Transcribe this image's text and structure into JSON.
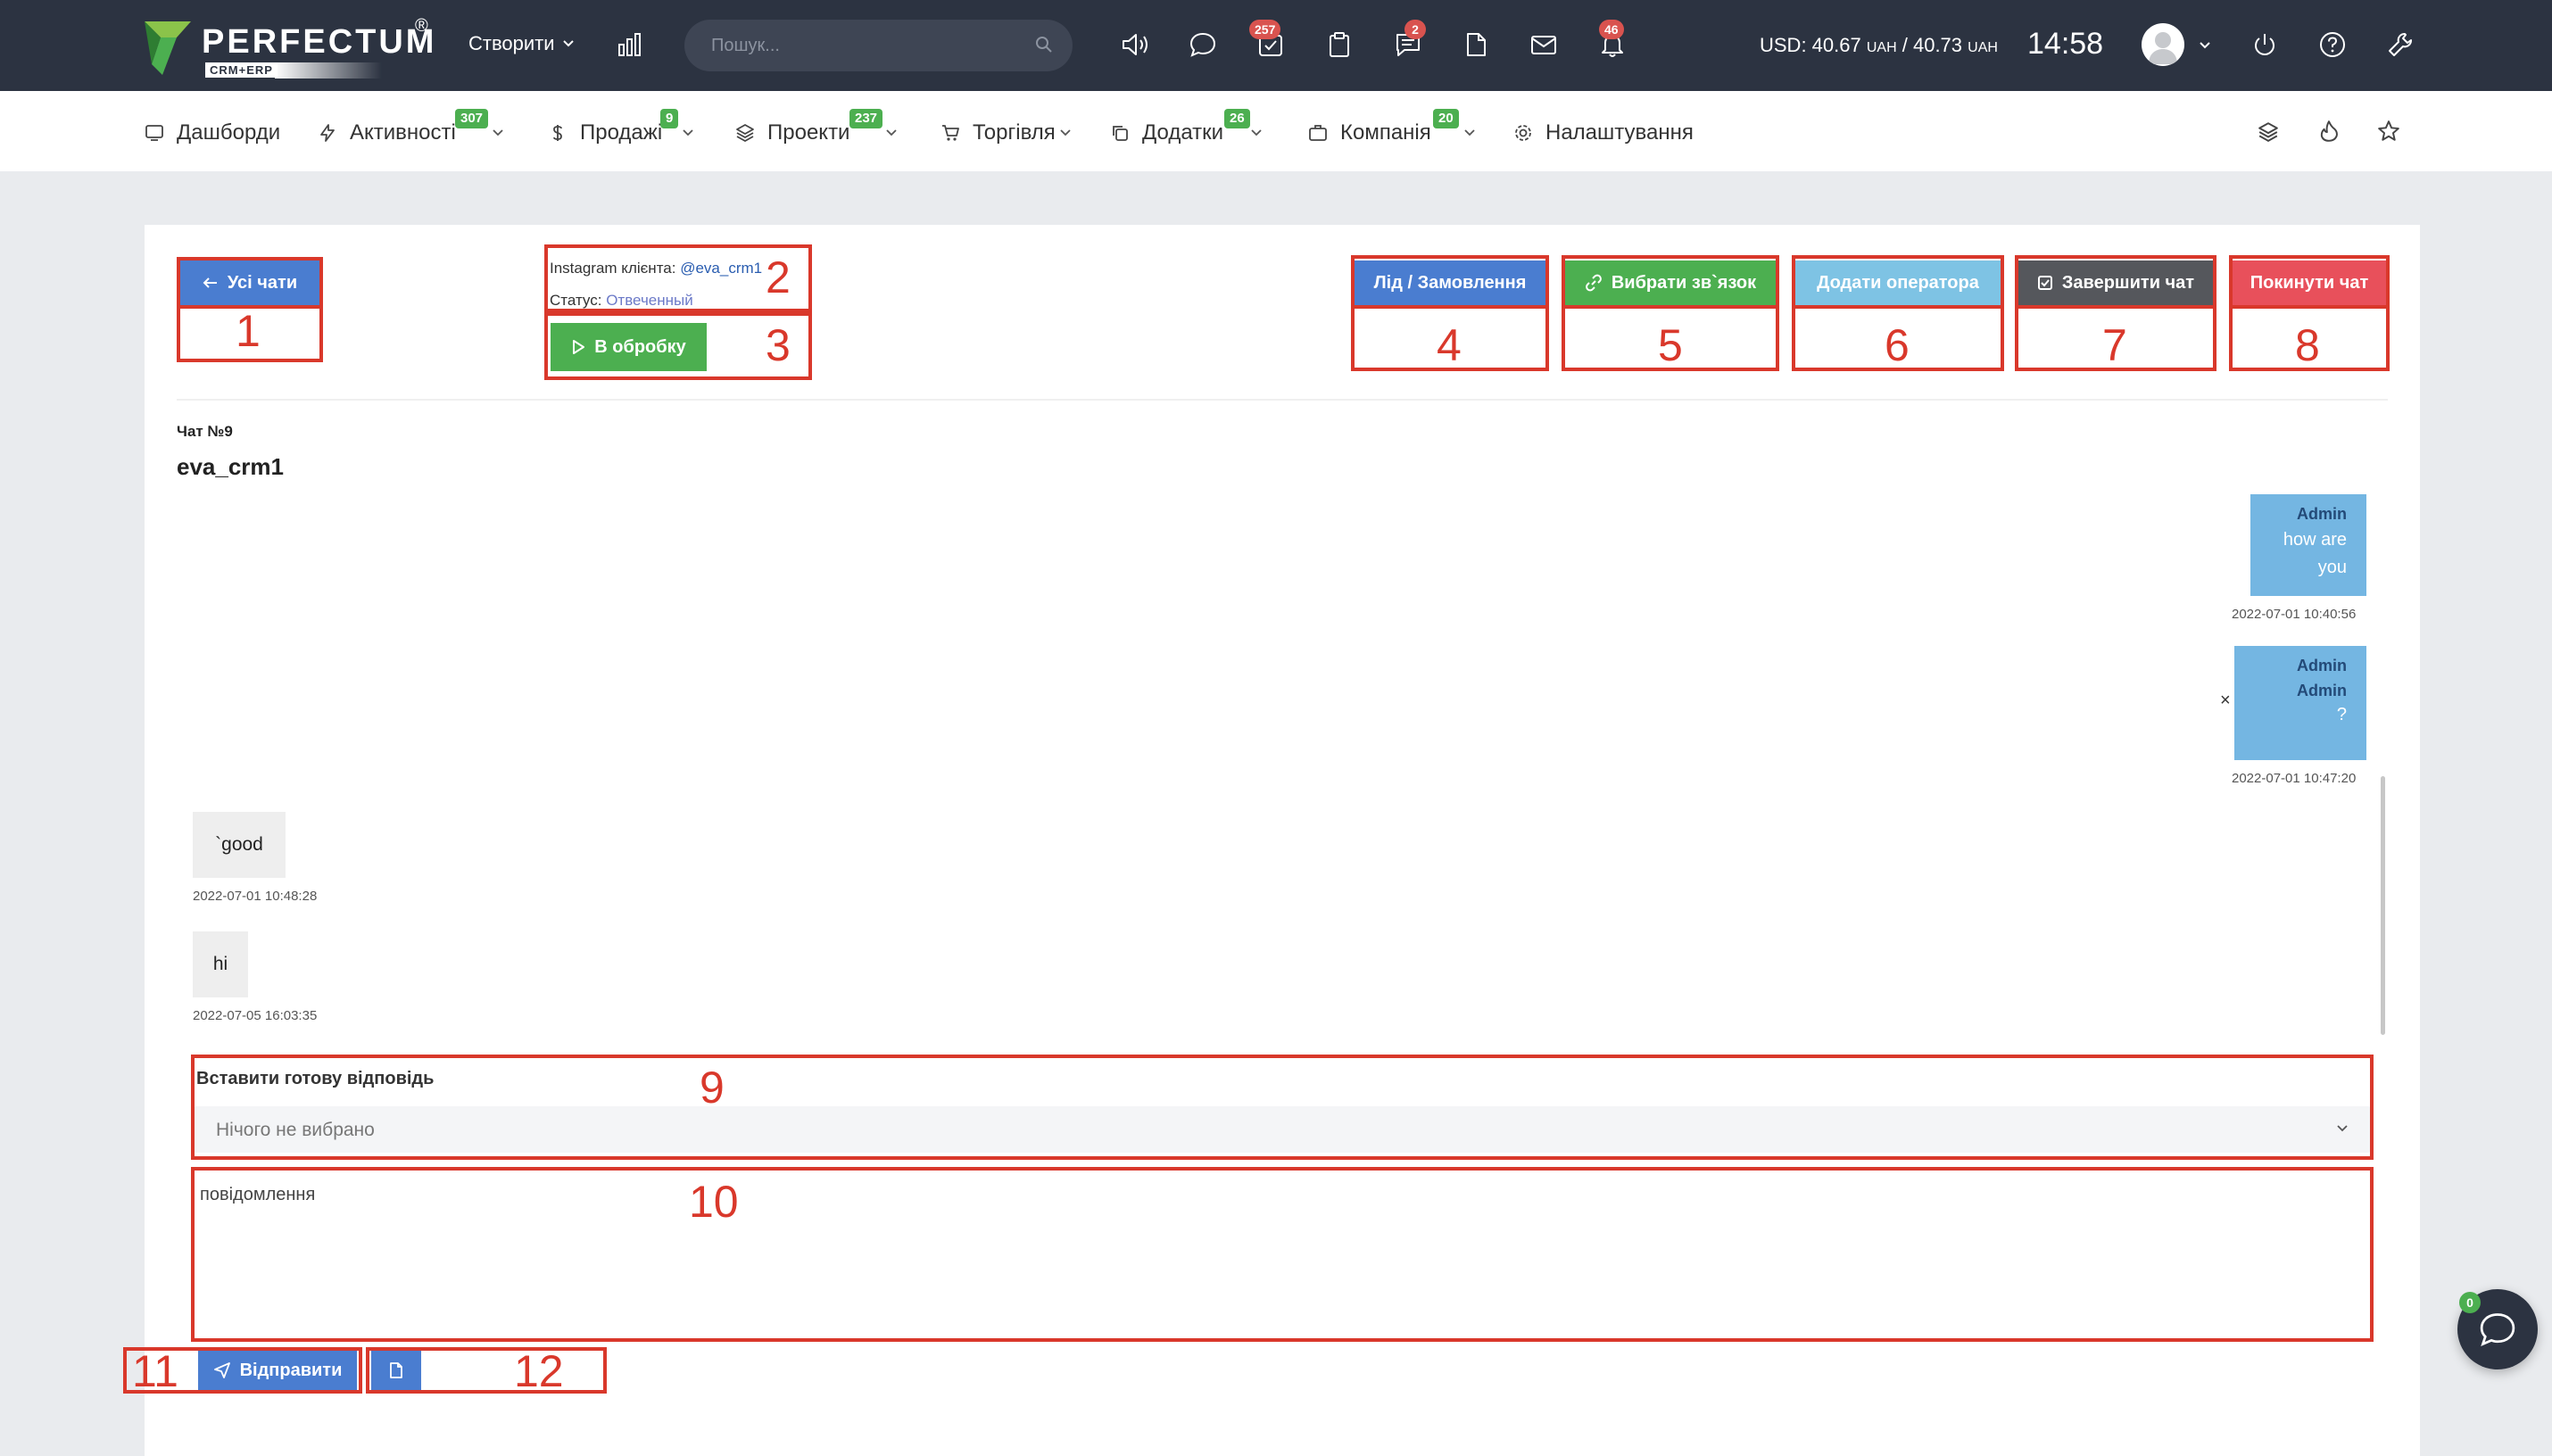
{
  "brand": {
    "name": "PERFECTUM",
    "reg": "®",
    "subtitle": "CRM+ERP"
  },
  "topbar": {
    "create_label": "Створити",
    "search_placeholder": "Пошук...",
    "badges": {
      "tasks": "257",
      "chat": "2",
      "notifications": "46"
    },
    "currency_text": "USD: 40.67",
    "currency_unit1": "UAH",
    "currency_sep": " / 40.73",
    "currency_unit2": "UAH",
    "time": "14:58",
    "icons": [
      "chart-icon",
      "sound-icon",
      "message-icon",
      "tasks-icon",
      "clipboard-icon",
      "chat-icon",
      "file-icon",
      "mail-icon",
      "bell-icon",
      "power-icon",
      "help-icon",
      "wrench-icon"
    ]
  },
  "nav": {
    "items": [
      {
        "label": "Дашборди",
        "badge": ""
      },
      {
        "label": "Активності",
        "badge": "307"
      },
      {
        "label": "Продажі",
        "badge": "9"
      },
      {
        "label": "Проекти",
        "badge": "237"
      },
      {
        "label": "Торгівля",
        "badge": ""
      },
      {
        "label": "Додатки",
        "badge": "26"
      },
      {
        "label": "Компанія",
        "badge": "20"
      },
      {
        "label": "Налаштування",
        "badge": ""
      }
    ]
  },
  "chat": {
    "back_label": "Усі чати",
    "client_label": "Instagram клієнта:",
    "client_handle": "@eva_crm1",
    "status_label": "Статус:",
    "status_value": "Отвеченный",
    "process_label": "В обробку",
    "buttons": {
      "lead": "Лід / Замовлення",
      "link": "Вибрати зв`язок",
      "operator": "Додати оператора",
      "finish": "Завершити чат",
      "leave": "Покинути чат"
    },
    "chat_no": "Чат №9",
    "name": "eva_crm1",
    "messages": [
      {
        "author": "Admin",
        "lines": [
          "how are",
          "you"
        ],
        "time": "2022-07-01 10:40:56"
      },
      {
        "author": "Admin",
        "lines": [
          "Admin",
          "?"
        ],
        "time": "2022-07-01 10:47:20"
      },
      {
        "text": "`good",
        "time": "2022-07-01 10:48:28"
      },
      {
        "text": "hi",
        "time": "2022-07-05 16:03:35"
      }
    ],
    "delete_glyph": "×",
    "ready_reply_label": "Вставити готову відповідь",
    "ready_reply_value": "Нічого не вибрано",
    "message_placeholder": "повідомлення",
    "send_label": "Відправити"
  },
  "annotations": [
    "1",
    "2",
    "3",
    "4",
    "5",
    "6",
    "7",
    "8",
    "9",
    "10",
    "11",
    "12"
  ],
  "fab_badge": "0",
  "colors": {
    "topbar": "#2c3341",
    "accent_blue": "#4a7dd0",
    "green": "#4caf50",
    "sky": "#7ec3e4",
    "dark": "#55575c",
    "red": "#e8505b",
    "annotation": "#d9382b"
  }
}
